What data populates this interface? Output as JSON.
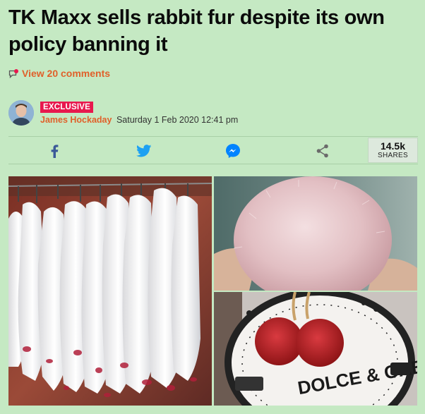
{
  "article": {
    "headline": "TK Maxx sells rabbit fur despite its own policy banning it",
    "comments_link": "View 20 comments",
    "badge": "EXCLUSIVE",
    "author": "James Hockaday",
    "published": "Saturday 1 Feb 2020 12:41 pm"
  },
  "share": {
    "buttons": [
      "facebook-icon",
      "twitter-icon",
      "messenger-icon",
      "share-icon"
    ],
    "count": "14.5k",
    "count_label": "SHARES"
  },
  "images": {
    "bag_brand_text": "DOLCE & GABBANA"
  },
  "colors": {
    "background": "#c5e9c3",
    "accent_orange": "#e0602a",
    "badge_pink": "#e8184e",
    "facebook_blue": "#3b5998",
    "twitter_blue": "#1da1f2",
    "messenger_blue": "#0084ff"
  }
}
